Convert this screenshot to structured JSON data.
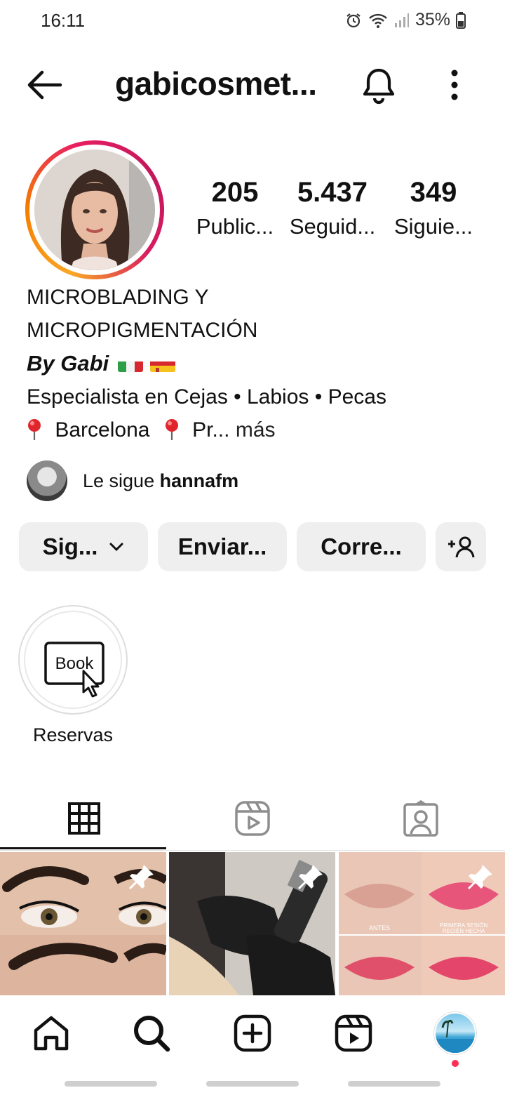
{
  "status_bar": {
    "time": "16:11",
    "battery": "35%"
  },
  "header": {
    "username": "gabicosmet..."
  },
  "stats": [
    {
      "value": "205",
      "label": "Public..."
    },
    {
      "value": "5.437",
      "label": "Seguid..."
    },
    {
      "value": "349",
      "label": "Siguie..."
    }
  ],
  "bio": {
    "line1": "MICROBLADING Y",
    "line2": "MICROPIGMENTACIÓN",
    "byline": "By Gabi",
    "line4": "Especialista en Cejas • Labios • Pecas",
    "location": "Barcelona",
    "truncated": "Pr...",
    "more": "más"
  },
  "followed_by": {
    "prefix": "Le sigue",
    "user": "hannafm"
  },
  "actions": {
    "follow": "Sig...",
    "message": "Enviar...",
    "email": "Corre..."
  },
  "highlight": {
    "icon_text": "Book",
    "label": "Reservas"
  },
  "grid_images": {
    "lips_before": "ANTES",
    "lips_after_1": "PRIMERA SESIÓN",
    "lips_after_2": "RECIÉN HECHA"
  },
  "colors": {
    "accent_pink": "#e91e63",
    "accent_orange": "#f57c00",
    "notify_dot": "#ff2d55",
    "button_bg": "#efefef"
  }
}
